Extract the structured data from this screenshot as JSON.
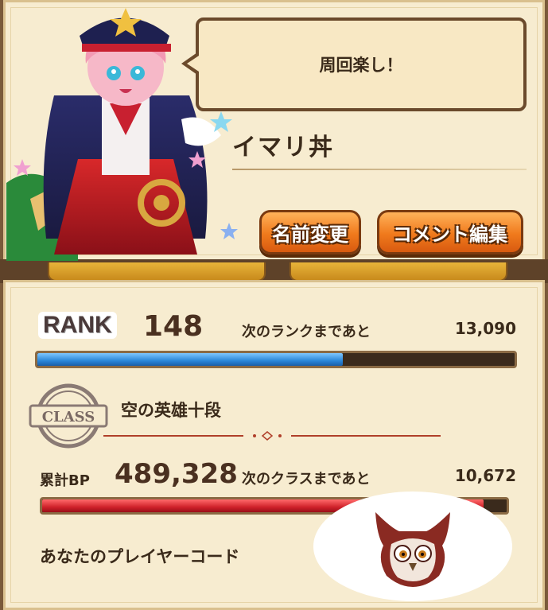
{
  "profile": {
    "comment": "周回楽し！",
    "player_name": "イマリ丼",
    "rename_label": "名前変更",
    "edit_comment_label": "コメント編集"
  },
  "stats": {
    "rank_label": "RANK",
    "rank_value": "148",
    "next_rank_label": "次のランクまであと",
    "next_rank_value": "13,090",
    "rank_progress": 0.64,
    "class_stamp_text": "CLASS",
    "class_name": "空の英雄十段",
    "bp_label": "累計BP",
    "bp_value": "489,328",
    "next_class_label": "次のクラスまであと",
    "next_class_value": "10,672",
    "bp_progress": 0.95,
    "player_code_label": "あなたのプレイヤーコード"
  },
  "colors": {
    "panel": "#f7ecd0",
    "rank_bar": "#2a86d8",
    "bp_bar": "#d0222a",
    "button": "#f07a1c"
  },
  "icons": {
    "owl": "owl-mascot-icon",
    "class_stamp": "class-stamp-icon"
  }
}
